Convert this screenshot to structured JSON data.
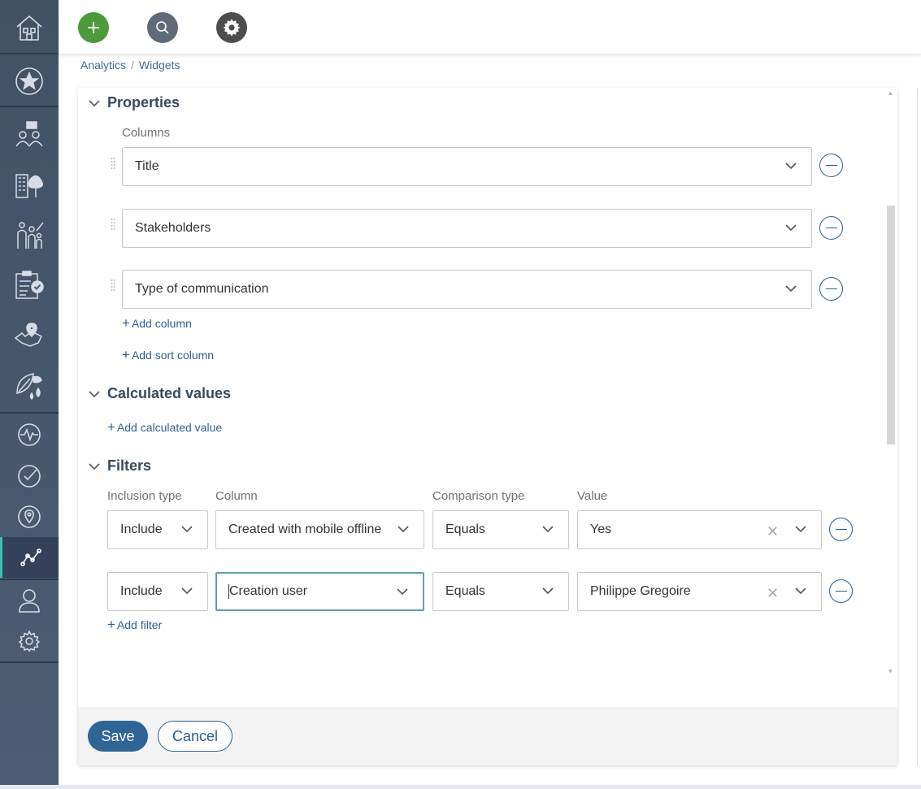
{
  "topbar": {
    "add_icon": "plus-icon",
    "search_icon": "search-icon",
    "settings_icon": "gear-icon"
  },
  "sidebar": {
    "items": [
      {
        "icon": "home-icon"
      },
      {
        "icon": "star-icon"
      },
      {
        "icon": "stakeholders-icon"
      },
      {
        "icon": "buildings-icon"
      },
      {
        "icon": "people-icon"
      },
      {
        "icon": "checklist-icon"
      },
      {
        "icon": "map-pin-region-icon"
      },
      {
        "icon": "leaf-water-icon"
      },
      {
        "icon": "activity-icon"
      },
      {
        "icon": "check-circle-icon"
      },
      {
        "icon": "location-icon"
      },
      {
        "icon": "analytics-icon",
        "active": true
      },
      {
        "icon": "user-icon"
      },
      {
        "icon": "settings-icon"
      }
    ]
  },
  "breadcrumb": {
    "items": [
      "Analytics",
      "Widgets"
    ]
  },
  "properties": {
    "title": "Properties",
    "columns_label": "Columns",
    "columns": [
      "Title",
      "Stakeholders",
      "Type of communication"
    ],
    "add_column": "Add column",
    "add_sort_column": "Add sort column"
  },
  "calculated": {
    "title": "Calculated values",
    "add_calculated": "Add calculated value"
  },
  "filters": {
    "title": "Filters",
    "headers": {
      "inclusion": "Inclusion type",
      "column": "Column",
      "comparison": "Comparison type",
      "value": "Value"
    },
    "rows": [
      {
        "inclusion": "Include",
        "column": "Created with mobile offline",
        "comparison": "Equals",
        "value": "Yes"
      },
      {
        "inclusion": "Include",
        "column": "Creation user",
        "comparison": "Equals",
        "value": "Philippe Gregoire"
      }
    ],
    "add_filter": "Add filter"
  },
  "footer": {
    "save": "Save",
    "cancel": "Cancel"
  },
  "colors": {
    "sidebar_bg": "#4a5a70",
    "accent": "#2f6497",
    "add_button": "#4c9a3c",
    "active_indicator": "#3dbfb8"
  }
}
